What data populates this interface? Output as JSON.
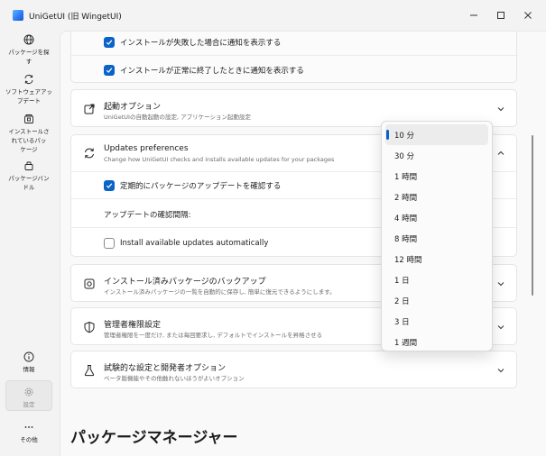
{
  "window": {
    "title": "UniGetUI (旧 WingetUI)",
    "controls": {
      "minimize": "—",
      "maximize": "☐",
      "close": "✕"
    }
  },
  "sidebar": {
    "items": [
      {
        "label": "パッケージを探\nす",
        "icon": "globe-icon"
      },
      {
        "label": "ソフトウェアアッ\nプデート",
        "icon": "refresh-icon"
      },
      {
        "label": "インストールさ\nれているパッ\nケージ",
        "icon": "installed-icon"
      },
      {
        "label": "パッケージバン\nドル",
        "icon": "bundle-icon"
      }
    ],
    "bottom": [
      {
        "label": "情報",
        "icon": "info-icon"
      },
      {
        "label": "設定",
        "icon": "gear-icon",
        "active": true
      },
      {
        "label": "その他",
        "icon": "more-icon"
      }
    ]
  },
  "notifications": {
    "fail_label": "インストールが失敗した場合に通知を表示する",
    "success_label": "インストールが正常に終了したときに通知を表示する"
  },
  "startup": {
    "title": "起動オプション",
    "subtitle": "UniGetUIの自動起動の設定, アプリケーション起動設定"
  },
  "updates": {
    "title": "Updates preferences",
    "subtitle": "Change how UniGetUI checks and installs available updates for your packages",
    "check_label": "定期的にパッケージのアップデートを確認する",
    "interval_label": "アップデートの確認間隔:",
    "auto_label": "Install available updates automatically"
  },
  "backup": {
    "title": "インストール済みパッケージのバックアップ",
    "subtitle": "インストール済みパッケージの一覧を自動的に保存し, 簡単に復元できるようにします。"
  },
  "admin": {
    "title": "管理者権限設定",
    "subtitle": "管理者権限を一度だけ, または毎回要求し, デフォルトでインストールを昇格させる"
  },
  "experimental": {
    "title": "試験的な設定と開発者オプション",
    "subtitle": "ベータ版機能やその他触れないほうがよいオプション"
  },
  "section_title": "パッケージマネージャー",
  "interval_dropdown": {
    "selected": "10 分",
    "options": [
      "10 分",
      "30 分",
      "1 時間",
      "2 時間",
      "4 時間",
      "8 時間",
      "12 時間",
      "1 日",
      "2 日",
      "3 日",
      "1 週間"
    ]
  },
  "colors": {
    "accent": "#0a63c9"
  }
}
